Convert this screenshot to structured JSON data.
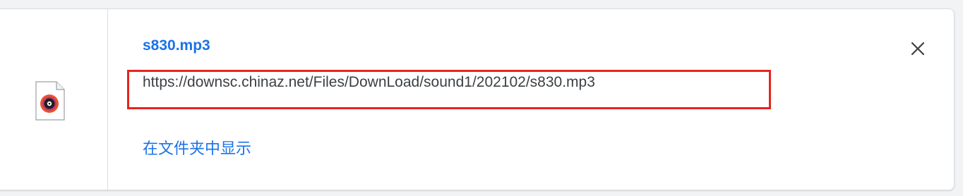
{
  "download": {
    "file_name": "s830.mp3",
    "url": "https://downsc.chinaz.net/Files/DownLoad/sound1/202102/s830.mp3",
    "show_in_folder_label": "在文件夹中显示",
    "file_icon": "audio-file-icon",
    "close_icon": "close-icon"
  },
  "colors": {
    "link": "#1a73e8",
    "text": "#3c4043",
    "highlight_border": "#e4251e",
    "background": "#f1f3f4",
    "card": "#ffffff"
  }
}
